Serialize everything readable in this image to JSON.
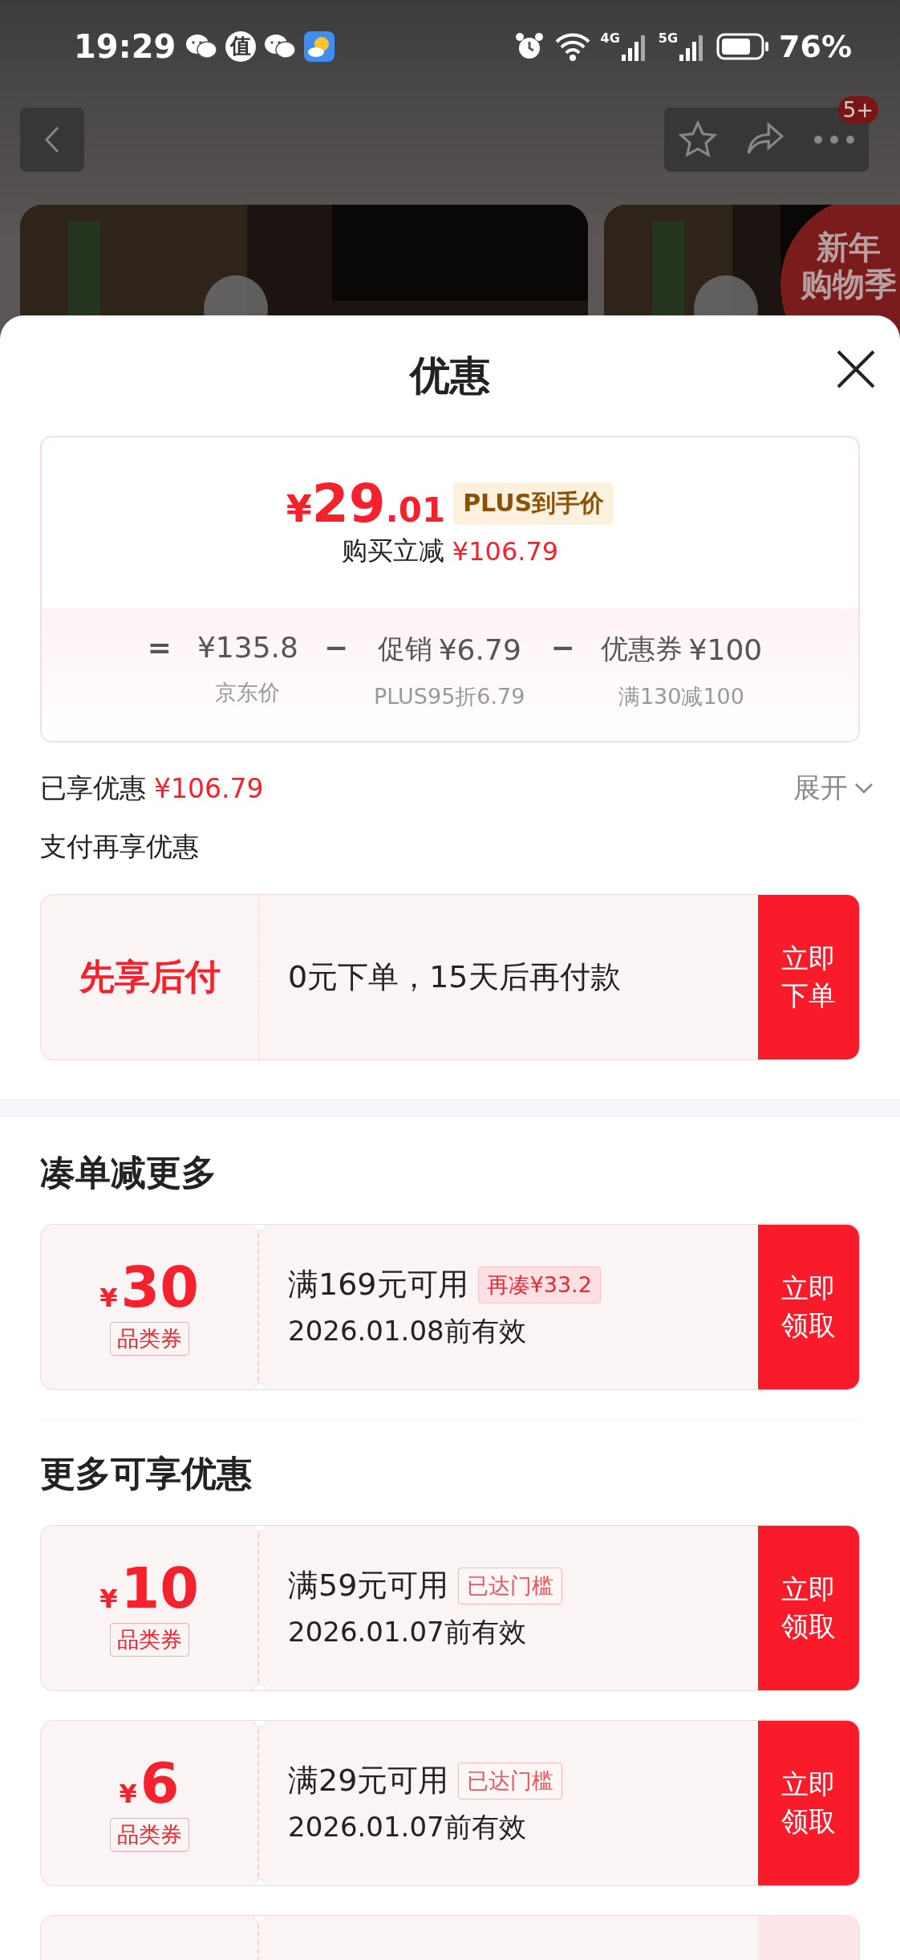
{
  "status_bar": {
    "time": "19:29",
    "notification_icons": [
      {
        "kind": "wechat"
      },
      {
        "kind": "app",
        "label": "值"
      },
      {
        "kind": "wechat"
      },
      {
        "kind": "weather"
      }
    ],
    "signals": [
      {
        "label": "4G"
      },
      {
        "label": "5G"
      }
    ],
    "battery": "76%"
  },
  "nav": {
    "badge": "5+"
  },
  "product_images": [
    {
      "kind": "picture"
    },
    {
      "kind": "picture",
      "tag_lines": [
        "新年",
        "购物季"
      ]
    }
  ],
  "sheet": {
    "title": "优惠",
    "price": {
      "currency": "¥",
      "integer": "29",
      "decimal": ".01",
      "label": "PLUS到手价"
    },
    "saving": {
      "label": "购买立减",
      "amount": "¥106.79"
    },
    "breakdown": [
      {
        "operator": "=",
        "amount": "¥135.8",
        "note": "京东价"
      },
      {
        "operator": "−",
        "name": "促销",
        "amount": "¥6.79",
        "note": "PLUS95折6.79"
      },
      {
        "operator": "−",
        "name": "优惠券",
        "amount": "¥100",
        "note": "满130减100"
      }
    ],
    "enjoyed": {
      "label": "已享优惠",
      "amount": "¥106.79",
      "toggle": "展开",
      "expanded": false
    },
    "pay": {
      "title": "支付再享优惠",
      "name": "先享后付",
      "description": "0元下单，15天后再付款",
      "button": "立即下单"
    },
    "sections": [
      {
        "title": "凑单减更多",
        "coupons": [
          {
            "kind": "gap",
            "currency": "¥",
            "amount": "30",
            "type": "品类券",
            "condition": "满169元可用",
            "tag": "再凑¥33.2",
            "expiry": "2026.01.08前有效",
            "button": "立即领取"
          }
        ]
      },
      {
        "title": "更多可享优惠",
        "coupons": [
          {
            "kind": "reached",
            "currency": "¥",
            "amount": "10",
            "type": "品类券",
            "condition": "满59元可用",
            "tag": "已达门槛",
            "expiry": "2026.01.07前有效",
            "button": "立即领取"
          },
          {
            "kind": "reached",
            "currency": "¥",
            "amount": "6",
            "type": "品类券",
            "condition": "满29元可用",
            "tag": "已达门槛",
            "expiry": "2026.01.07前有效",
            "button": "立即领取"
          },
          {
            "kind": "cut_off"
          }
        ]
      }
    ]
  }
}
